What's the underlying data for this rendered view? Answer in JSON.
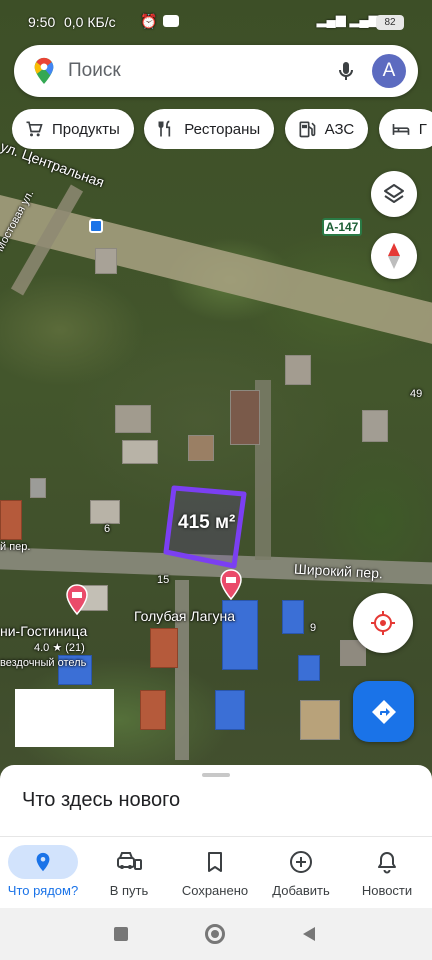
{
  "status_bar": {
    "time": "9:50",
    "network_speed": "0,0 КБ/с",
    "battery": "82"
  },
  "search": {
    "placeholder": "Поиск",
    "avatar_letter": "А"
  },
  "chips": [
    {
      "label": "Продукты",
      "icon": "cart-icon"
    },
    {
      "label": "Рестораны",
      "icon": "fork-knife-icon"
    },
    {
      "label": "АЗС",
      "icon": "gas-station-icon"
    },
    {
      "label": "Г",
      "icon": "bed-icon"
    }
  ],
  "map": {
    "street_labels": {
      "central": "ул. Центральная",
      "mostovaya": "Мостовая ул.",
      "shirokiy_right": "Широкий пер.",
      "shirokiy_left": "й пер.",
      "highway": "А-147"
    },
    "house_numbers": {
      "n49": "49",
      "n6": "6",
      "n15": "15",
      "n9": "9"
    },
    "area_measure": "415 м²",
    "places": {
      "laguna": "Голубая Лагуна",
      "hotel_name": "ни-Гостиница",
      "hotel_rating": "4.0 ★ (21)",
      "hotel_type": "вездочный отель"
    }
  },
  "sheet": {
    "title": "Что здесь нового"
  },
  "bottom_nav": [
    {
      "label": "Что рядом?",
      "icon": "location-pin-icon",
      "active": true
    },
    {
      "label": "В путь",
      "icon": "car-icon",
      "active": false
    },
    {
      "label": "Сохранено",
      "icon": "bookmark-icon",
      "active": false
    },
    {
      "label": "Добавить",
      "icon": "add-circle-icon",
      "active": false
    },
    {
      "label": "Новости",
      "icon": "bell-icon",
      "active": false
    }
  ],
  "colors": {
    "accent": "#1a73e8",
    "polygon": "#7b3ff2",
    "pin": "#ea4b6a"
  }
}
